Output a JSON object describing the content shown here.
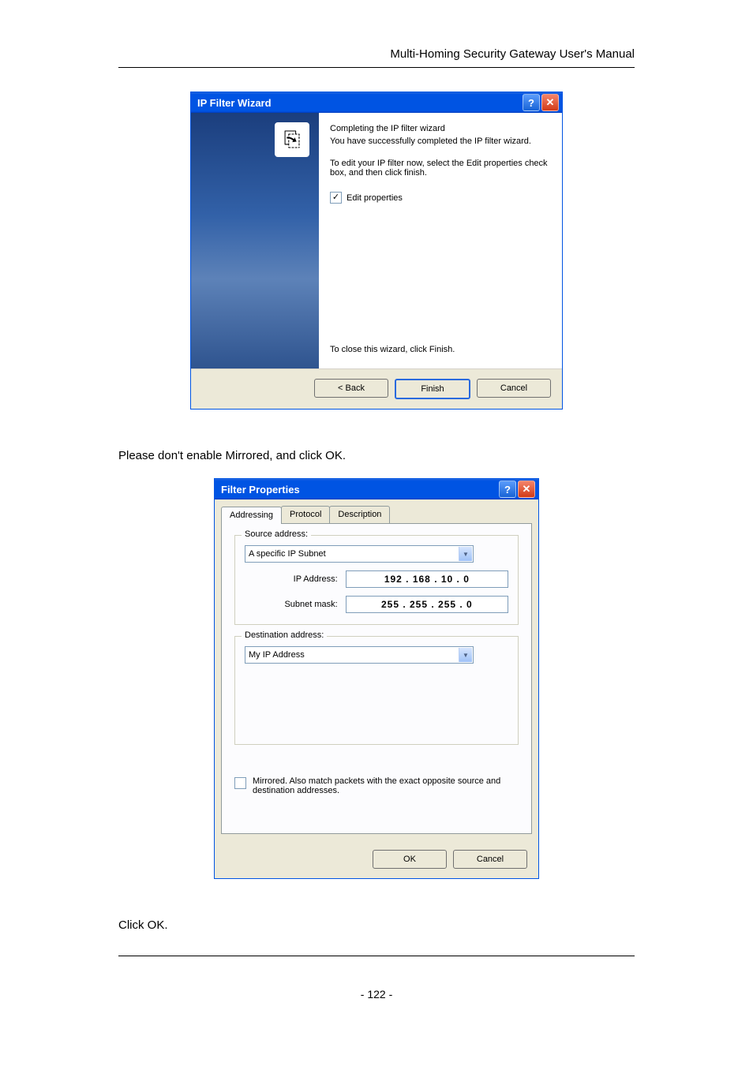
{
  "header": "Multi-Homing Security Gateway User's Manual",
  "wizard": {
    "title": "IP Filter Wizard",
    "line1": "Completing the IP filter wizard",
    "line2": "You have successfully completed the IP filter wizard.",
    "line3": "To edit your IP filter now, select the Edit properties check box, and then click finish.",
    "edit_label": "Edit properties",
    "close_text": "To close this wizard, click Finish.",
    "buttons": {
      "back": "< Back",
      "finish": "Finish",
      "cancel": "Cancel"
    }
  },
  "text1": "Please don't enable Mirrored, and click OK.",
  "filter": {
    "title": "Filter Properties",
    "tabs": {
      "addressing": "Addressing",
      "protocol": "Protocol",
      "description": "Description"
    },
    "source": {
      "legend": "Source address:",
      "dropdown": "A specific IP Subnet",
      "ip_label": "IP Address:",
      "ip_value": "192 . 168 .  10  .   0",
      "mask_label": "Subnet mask:",
      "mask_value": "255 . 255 . 255 .   0"
    },
    "dest": {
      "legend": "Destination address:",
      "dropdown": "My IP Address"
    },
    "mirrored": "Mirrored. Also match packets with the exact opposite source and destination addresses.",
    "buttons": {
      "ok": "OK",
      "cancel": "Cancel"
    }
  },
  "text2": "Click OK.",
  "page_number": "- 122 -"
}
